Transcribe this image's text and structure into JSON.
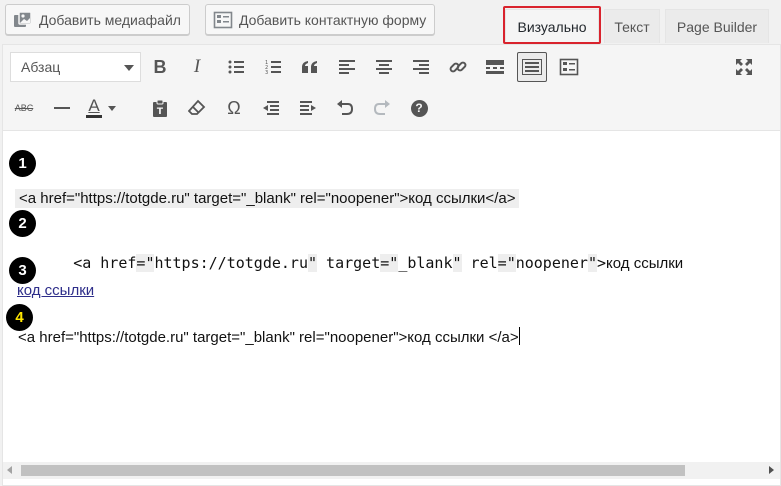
{
  "top_buttons": {
    "add_media": "Добавить медиафайл",
    "add_contact_form": "Добавить контактную форму"
  },
  "tabs": {
    "visual": "Визуально",
    "text": "Текст",
    "page_builder": "Page Builder"
  },
  "toolbar": {
    "format_select_value": "Абзац",
    "strikethrough_glyph": "ABC",
    "text_color_glyph": "A",
    "special_chars_glyph": "Ω",
    "bold_glyph": "B",
    "italic_glyph": "I",
    "help_glyph": "?"
  },
  "content": {
    "markers": [
      "1",
      "2",
      "3",
      "4"
    ],
    "line1": "<a href=\"https://totgde.ru\" target=\"_blank\" rel=\"noopener\">код ссылки</a>",
    "line2_tokens": [
      "<",
      "a href",
      "=",
      "\"",
      "https://totgde.ru",
      "\"",
      " target",
      "=",
      "\"",
      "_blank",
      "\"",
      " rel",
      "=",
      "\"",
      "noopener",
      "\"",
      ">",
      "код ссылки"
    ],
    "line3_link": "код ссылки ",
    "line4": "<a href=\"https://totgde.ru\" target=\"_blank\" rel=\"noopener\">код ссылки </a>"
  },
  "colors": {
    "highlight_border": "#d9232d",
    "marker_bg": "#000000",
    "marker_4_text": "#ffe600",
    "link": "#2e2e8a"
  },
  "icons": [
    "add-media-icon",
    "contact-form-icon",
    "bold",
    "italic",
    "bulleted-list-icon",
    "numbered-list-icon",
    "blockquote-icon",
    "align-left-icon",
    "align-center-icon",
    "align-right-icon",
    "link-icon",
    "read-more-icon",
    "toolbar-toggle-icon",
    "form-icon",
    "fullscreen-icon",
    "strikethrough-icon",
    "horizontal-line-icon",
    "text-color-icon",
    "paste-text-icon",
    "clear-formatting-icon",
    "special-characters-icon",
    "outdent-icon",
    "indent-icon",
    "undo-icon",
    "redo-icon",
    "help-icon"
  ]
}
